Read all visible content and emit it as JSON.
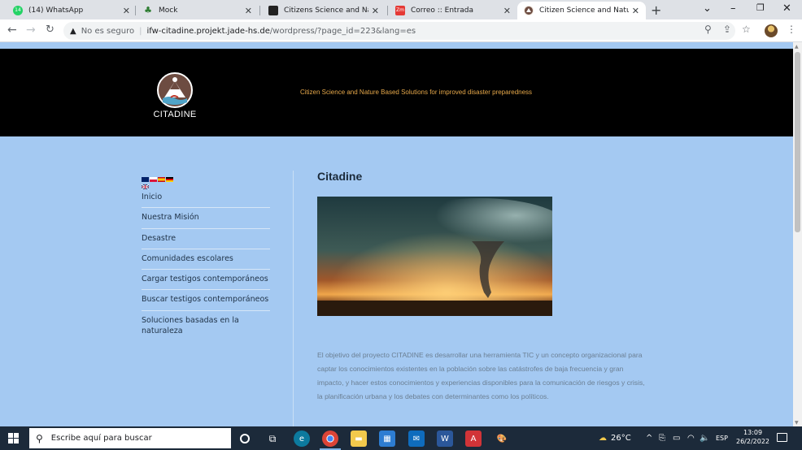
{
  "browser": {
    "tabs": [
      {
        "label": "(14) WhatsApp",
        "icon": "whatsapp-icon",
        "color": "#25d366",
        "badge": "14"
      },
      {
        "label": "Mock",
        "icon": "mock-tree-icon",
        "color": "#2e7d32"
      },
      {
        "label": "Citizens Science and Nature B",
        "icon": "doc-icon",
        "color": "#3a3a3a"
      },
      {
        "label": "Correo :: Entrada",
        "icon": "mail-zimbra-icon",
        "color": "#e53935"
      },
      {
        "label": "Citizen Science and Nature B",
        "icon": "citadine-icon",
        "color": "#6d4c41",
        "active": true
      }
    ],
    "security_label": "No es seguro",
    "url_host": "ifw-citadine.projekt.jade-hs.de",
    "url_path": "/wordpress/?page_id=223&lang=es"
  },
  "site": {
    "logo_text": "CITADINE",
    "tagline": "Citizen Science and Nature Based Solutions for improved disaster preparedness",
    "nav": [
      "Inicio",
      "Nuestra Misión",
      "Desastre",
      "Comunidades escolares",
      "Cargar testigos contemporáneos",
      "Buscar testigos contemporáneos",
      "Soluciones basadas en la naturaleza"
    ],
    "flags": [
      "uk",
      "pl",
      "es",
      "de"
    ],
    "title": "Citadine",
    "body": "El objetivo del proyecto CITADINE es desarrollar una herramienta TIC y un concepto organizacional para captar los conocimientos existentes en la población sobre las catástrofes de baja frecuencia y gran impacto, y hacer estos conocimientos y experiencias disponibles para la comunicación de riesgos y crisis, la planificación urbana y los debates con determinantes como los políticos."
  },
  "taskbar": {
    "search_placeholder": "Escribe aquí para buscar",
    "weather": "26°C",
    "language": "ESP",
    "time": "13:09",
    "date": "26/2/2022"
  }
}
